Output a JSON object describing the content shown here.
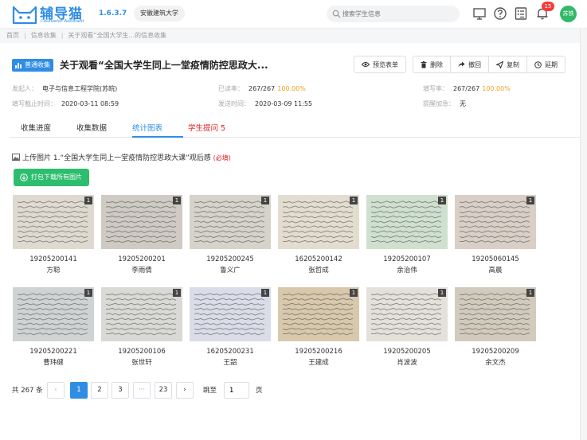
{
  "header": {
    "logo_text": "辅导猫",
    "logo_sub": "Counselor Assistant",
    "version": "1.6.3.7",
    "school": "安徽建筑大学",
    "search_placeholder": "搜索学生信息",
    "notification_count": "15",
    "avatar_text": "苏铁"
  },
  "breadcrumb": [
    "首页",
    "信息收集",
    "关于观看“全国大学生...的信息收集"
  ],
  "title_row": {
    "type_badge": "普通收集",
    "title": "关于观看“全国大学生同上一堂疫情防控思政大...",
    "preview_button": "预览表单",
    "actions": [
      {
        "label": "删除",
        "icon": "trash-icon"
      },
      {
        "label": "撤回",
        "icon": "share-icon"
      },
      {
        "label": "复制",
        "icon": "send-icon"
      },
      {
        "label": "延期",
        "icon": "clock-icon"
      }
    ]
  },
  "meta": {
    "sender_label": "发起人：",
    "sender": "电子与信息工程学院(苏皖)",
    "read_label": "已读率：",
    "read_value": "267/267",
    "read_pct": "100.00%",
    "fill_label": "填写率：",
    "fill_value": "267/267",
    "fill_pct": "100.00%",
    "deadline_label": "填写截止时间：",
    "deadline": "2020-03-11 08:59",
    "sent_label": "发送时间：",
    "sent": "2020-03-09 11:55",
    "remind_label": "提醒加急：",
    "remind": "无"
  },
  "tabs": [
    "收集进度",
    "收集数据",
    "统计图表",
    "学生提问 5"
  ],
  "question": {
    "text": "上传图片  1.“全国大学生同上一堂疫情防控思政大课”观后感",
    "required": "(必填)",
    "download_button": "打包下载所有图片"
  },
  "gallery": [
    {
      "id": "19205200141",
      "name": "方聪",
      "count": "1",
      "paper": "#dedad0"
    },
    {
      "id": "19205200201",
      "name": "李雨倩",
      "count": "1",
      "paper": "#cfcbc4"
    },
    {
      "id": "19205200245",
      "name": "鲁义广",
      "count": "1",
      "paper": "#d6d3cb"
    },
    {
      "id": "16205200142",
      "name": "张哲成",
      "count": "1",
      "paper": "#e2ddcf"
    },
    {
      "id": "19205200107",
      "name": "余治伟",
      "count": "1",
      "paper": "#cfe0cf"
    },
    {
      "id": "19205060145",
      "name": "高晨",
      "count": "1",
      "paper": "#d9cfc6"
    },
    {
      "id": "19205200221",
      "name": "曹玮健",
      "count": "1",
      "paper": "#cfd3d4"
    },
    {
      "id": "19205200106",
      "name": "张世轩",
      "count": "1",
      "paper": "#d9d9d6"
    },
    {
      "id": "16205200231",
      "name": "王韶",
      "count": "1",
      "paper": "#dadce8"
    },
    {
      "id": "19205200216",
      "name": "王建成",
      "count": "1",
      "paper": "#d8c9ad"
    },
    {
      "id": "19205200205",
      "name": "肖波波",
      "count": "1",
      "paper": "#e4e1da"
    },
    {
      "id": "19205200209",
      "name": "余文杰",
      "count": "1",
      "paper": "#d2cbbd"
    }
  ],
  "pager": {
    "total": "共 267 条",
    "pages": [
      "1",
      "2",
      "3",
      "···",
      "23"
    ],
    "prev": "‹",
    "next": "›",
    "goto_label": "跳至",
    "goto_value": "1",
    "goto_suffix": "页"
  }
}
